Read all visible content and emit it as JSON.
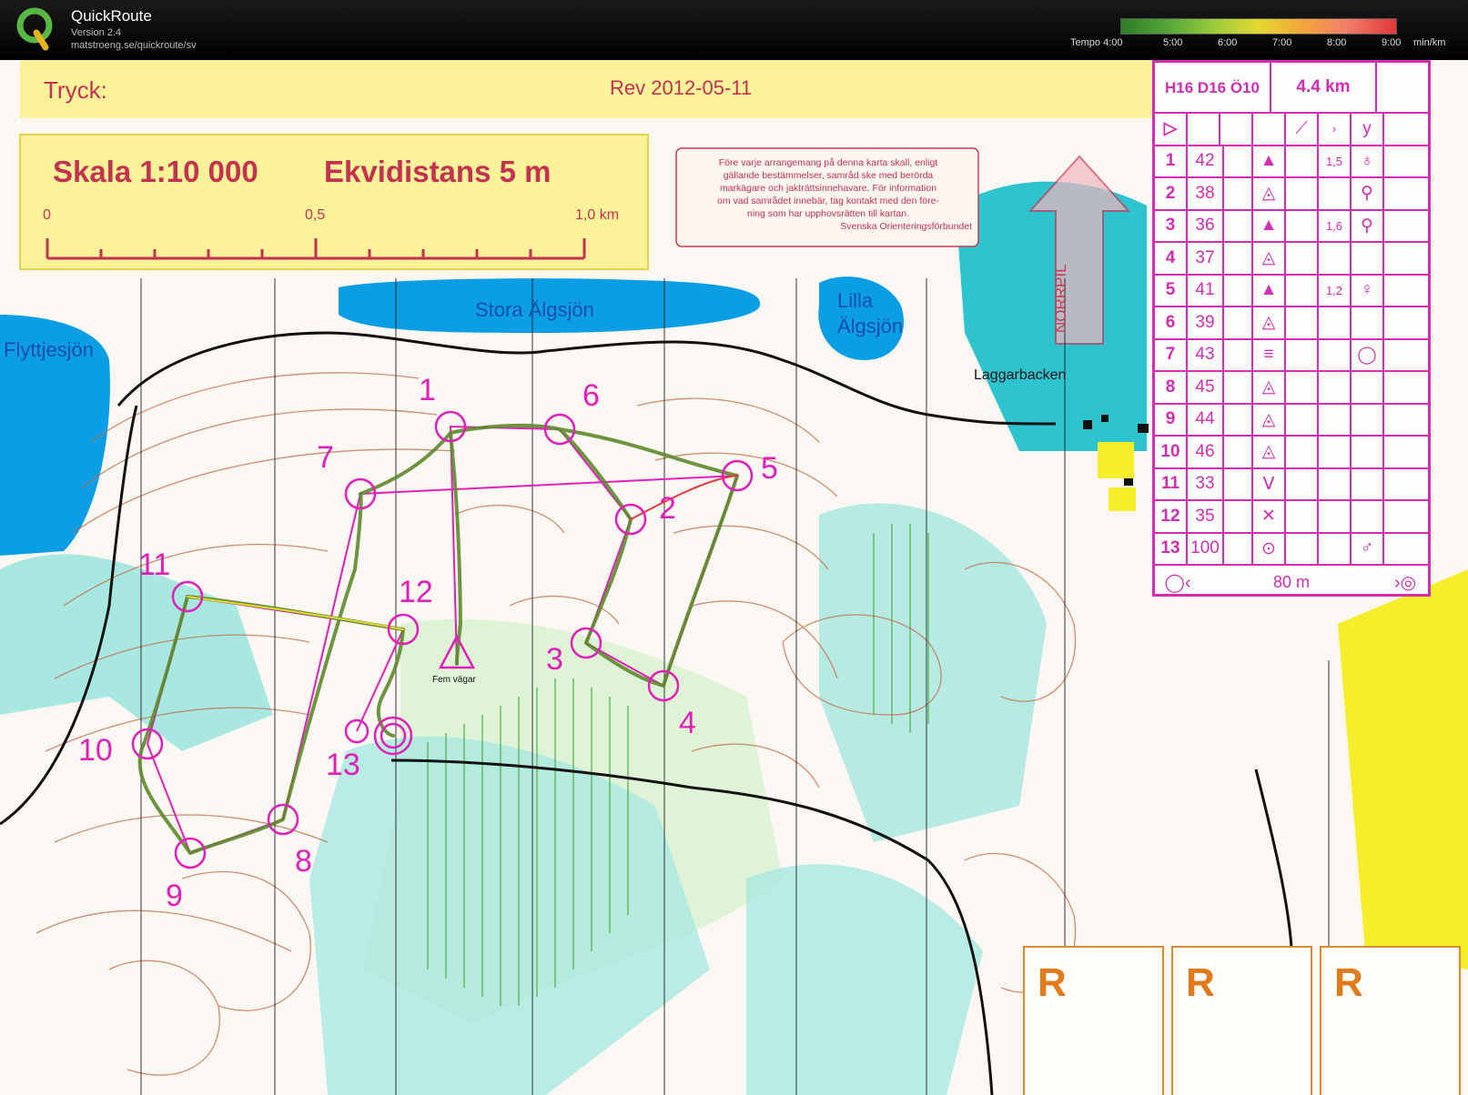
{
  "app": {
    "title": "QuickRoute",
    "version": "Version 2.4",
    "url": "matstroeng.se/quickroute/sv"
  },
  "pace_legend": {
    "ticks": [
      "Tempo 4:00",
      "5:00",
      "6:00",
      "7:00",
      "8:00",
      "9:00"
    ],
    "unit": "min/km"
  },
  "map": {
    "print_label": "Tryck:",
    "revision": "Rev 2012-05-11",
    "scale": "Skala 1:10 000",
    "contour": "Ekvidistans 5 m",
    "scalebar_labels": [
      "0",
      "0,5",
      "1,0 km"
    ],
    "notice_lines": [
      "Före varje arrangemang på denna karta skall, enligt",
      "gällande bestämmelser, samråd ske med berörda",
      "markägare och jakträttsinnehavare. För information",
      "om vad samrådet innebär, tag kontakt med den före-",
      "ning som har upphovsrätten till kartan.",
      "Svenska Orienteringsförbundet"
    ],
    "north_label": "NORRPIL",
    "places": {
      "lake_big": "Stora Älgsjön",
      "lake_small_1": "Lilla",
      "lake_small_2": "Älgsjön",
      "lake_west": "Flyttjesjön",
      "village": "Laggarbacken",
      "crossing": "Fem vägar"
    },
    "control_numbers": [
      "1",
      "2",
      "3",
      "4",
      "5",
      "6",
      "7",
      "8",
      "9",
      "10",
      "11",
      "12",
      "13"
    ],
    "route_colors": {
      "slow": "#e23838",
      "mid": "#e3d830",
      "fast": "#2f7d28"
    }
  },
  "control_table": {
    "class_label": "H16 D16 Ö10",
    "length": "4.4 km",
    "rows": [
      {
        "n": "1",
        "code": "42",
        "extra": "1,5"
      },
      {
        "n": "2",
        "code": "38",
        "extra": ""
      },
      {
        "n": "3",
        "code": "36",
        "extra": "1,6"
      },
      {
        "n": "4",
        "code": "37",
        "extra": ""
      },
      {
        "n": "5",
        "code": "41",
        "extra": "1,2"
      },
      {
        "n": "6",
        "code": "39",
        "extra": ""
      },
      {
        "n": "7",
        "code": "43",
        "extra": ""
      },
      {
        "n": "8",
        "code": "45",
        "extra": ""
      },
      {
        "n": "9",
        "code": "44",
        "extra": ""
      },
      {
        "n": "10",
        "code": "46",
        "extra": ""
      },
      {
        "n": "11",
        "code": "33",
        "extra": ""
      },
      {
        "n": "12",
        "code": "35",
        "extra": ""
      },
      {
        "n": "13",
        "code": "100",
        "extra": ""
      }
    ],
    "finish_distance": "80 m"
  },
  "r_boxes": [
    "R",
    "R",
    "R"
  ]
}
